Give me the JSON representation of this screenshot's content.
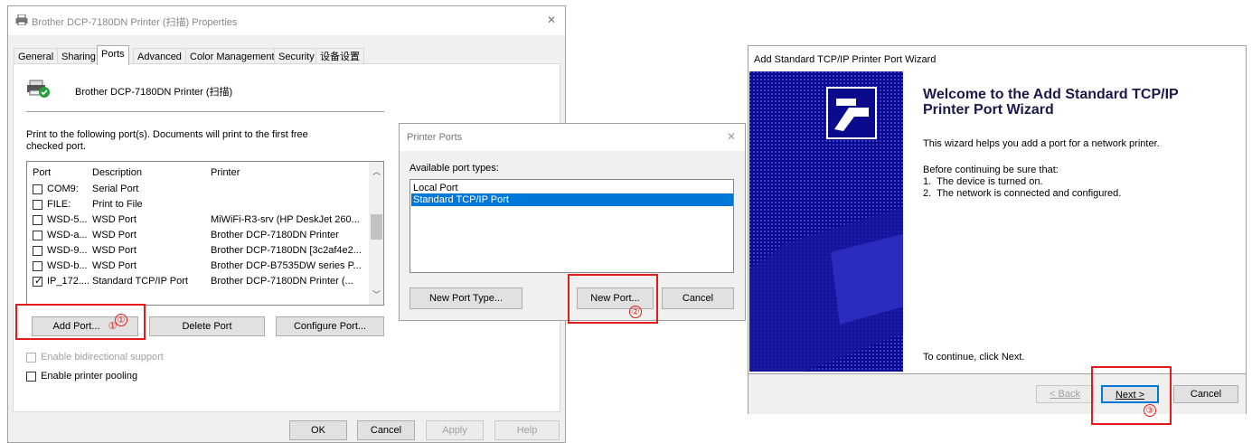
{
  "props": {
    "title": "Brother DCP-7180DN Printer (扫描) Properties",
    "tabs": [
      "General",
      "Sharing",
      "Ports",
      "Advanced",
      "Color Management",
      "Security",
      "设备设置"
    ],
    "printer_name": "Brother DCP-7180DN Printer (扫描)",
    "description": "Print to the following port(s). Documents will print to the first free checked port.",
    "columns": [
      "Port",
      "Description",
      "Printer"
    ],
    "rows": [
      {
        "port": "COM9:",
        "desc": "Serial Port",
        "printer": "",
        "checked": false
      },
      {
        "port": "FILE:",
        "desc": "Print to File",
        "printer": "",
        "checked": false
      },
      {
        "port": "WSD-5...",
        "desc": "WSD Port",
        "printer": "MiWiFi-R3-srv (HP DeskJet 260...",
        "checked": false
      },
      {
        "port": "WSD-a...",
        "desc": "WSD Port",
        "printer": "Brother DCP-7180DN Printer",
        "checked": false
      },
      {
        "port": "WSD-9...",
        "desc": "WSD Port",
        "printer": "Brother DCP-7180DN [3c2af4e2...",
        "checked": false
      },
      {
        "port": "WSD-b...",
        "desc": "WSD Port",
        "printer": "Brother DCP-B7535DW series P...",
        "checked": false
      },
      {
        "port": "IP_172....",
        "desc": "Standard TCP/IP Port",
        "printer": "Brother DCP-7180DN Printer (...",
        "checked": true
      }
    ],
    "add_port": "Add Port...",
    "delete_port": "Delete Port",
    "configure_port": "Configure Port...",
    "bidirectional": "Enable bidirectional support",
    "pooling": "Enable printer pooling",
    "ok": "OK",
    "cancel": "Cancel",
    "apply": "Apply",
    "help": "Help",
    "close_glyph": "✕",
    "marker": "①"
  },
  "ports_dialog": {
    "title": "Printer Ports",
    "available_label": "Available port types:",
    "types": [
      {
        "label": "Local Port",
        "selected": false
      },
      {
        "label": "Standard TCP/IP Port",
        "selected": true
      }
    ],
    "new_port_type": "New Port Type...",
    "new_port": "New Port...",
    "cancel": "Cancel",
    "close_glyph": "✕",
    "marker": "②"
  },
  "wizard": {
    "title": "Add Standard TCP/IP Printer Port Wizard",
    "heading": "Welcome to the Add Standard TCP/IP Printer Port Wizard",
    "intro": "This wizard helps you add a port for a network printer.",
    "before": "Before continuing be sure that:",
    "items": [
      "1.  The device is turned on.",
      "2.  The network is connected and configured."
    ],
    "continue": "To continue, click Next.",
    "back": "< Back",
    "next": "Next >",
    "cancel": "Cancel",
    "marker": "③"
  },
  "colors": {
    "selection": "#0078d7",
    "wizard_banner": "#0a0a8c",
    "annotation": "#e31b1b"
  }
}
